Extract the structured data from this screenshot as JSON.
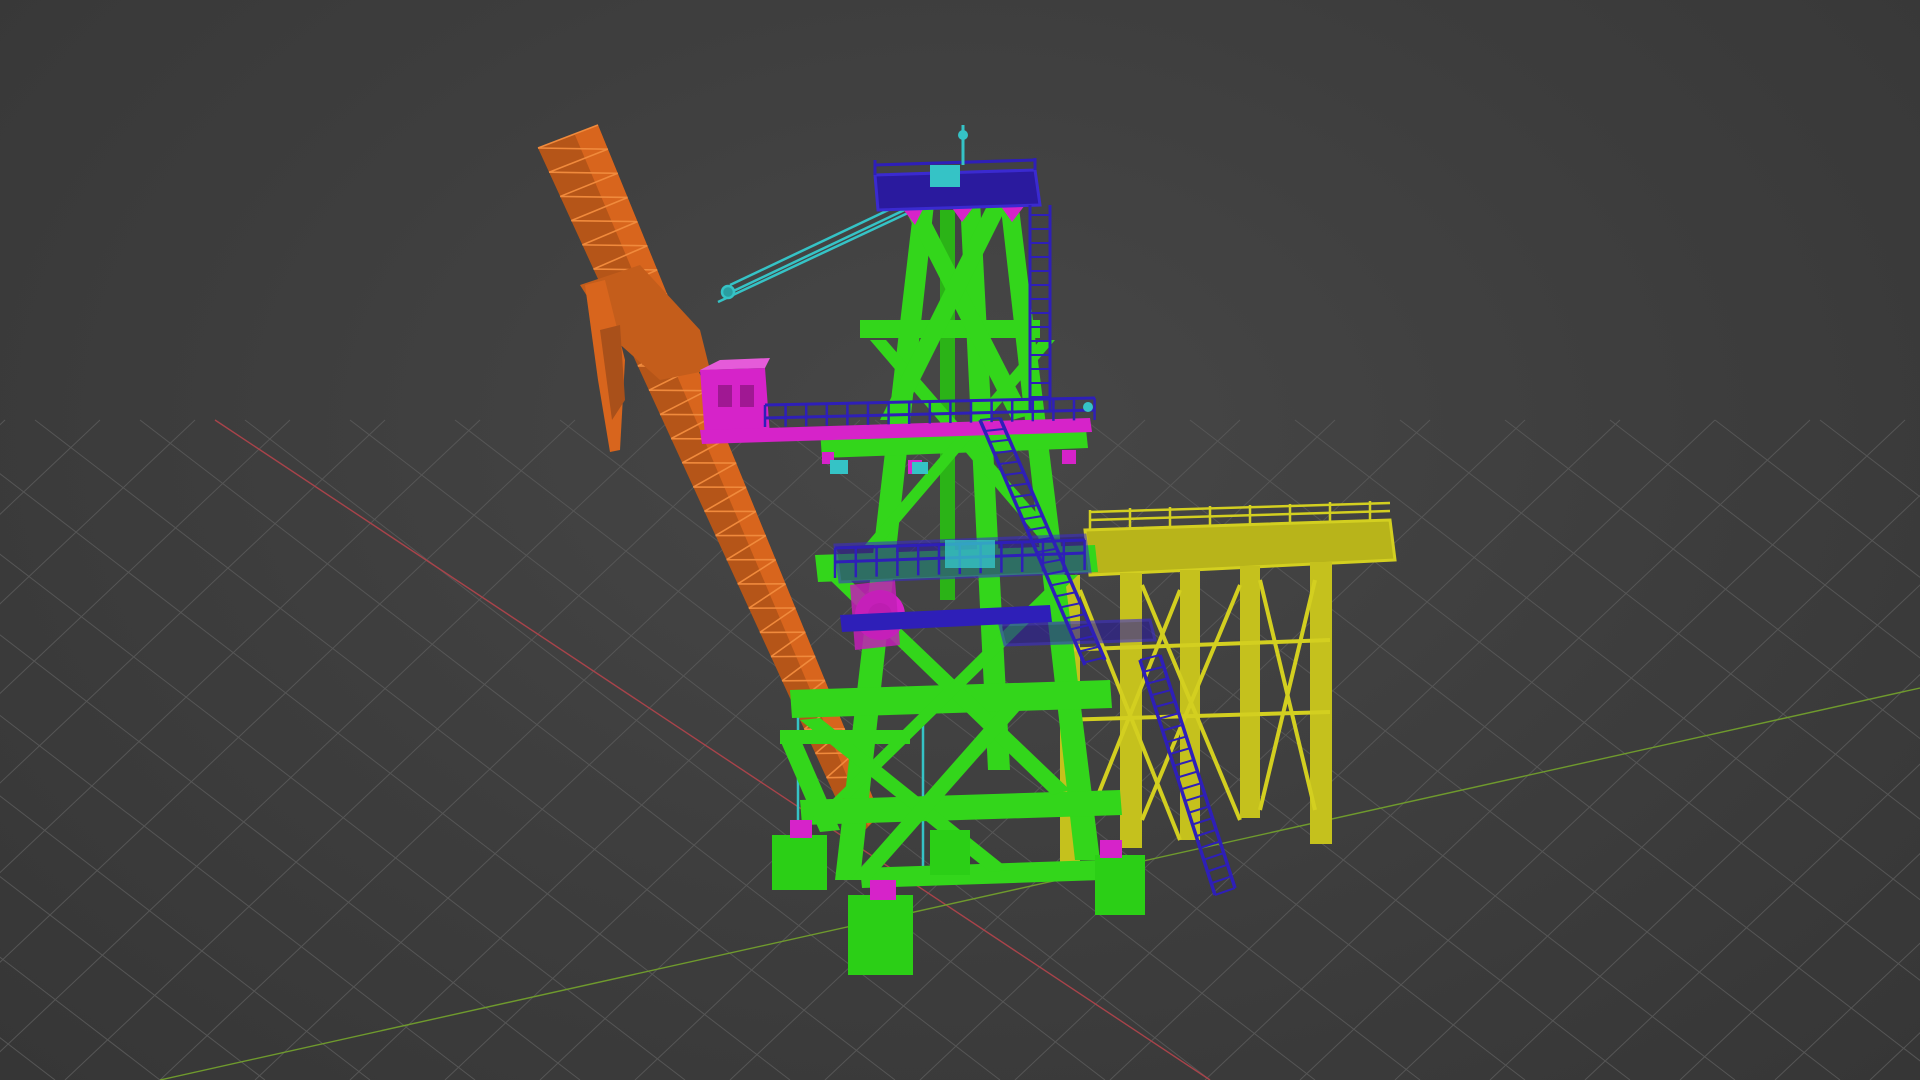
{
  "viewport": {
    "name": "3D Viewport",
    "background_color": "#3d3d3d",
    "grid_color": "#565656",
    "axis_x_color": "#a8434a",
    "axis_y_color": "#6f9a2d"
  },
  "scene": {
    "objects": [
      {
        "name": "boom-conveyor",
        "color": "#d8651d"
      },
      {
        "name": "tower-frame",
        "color": "#33d61b"
      },
      {
        "name": "platforms-railings",
        "color": "#2e1fb8"
      },
      {
        "name": "cabin-equipment",
        "color": "#d623c9"
      },
      {
        "name": "cables-details",
        "color": "#35c3c6"
      },
      {
        "name": "side-platform",
        "color": "#d3cf20"
      }
    ]
  }
}
